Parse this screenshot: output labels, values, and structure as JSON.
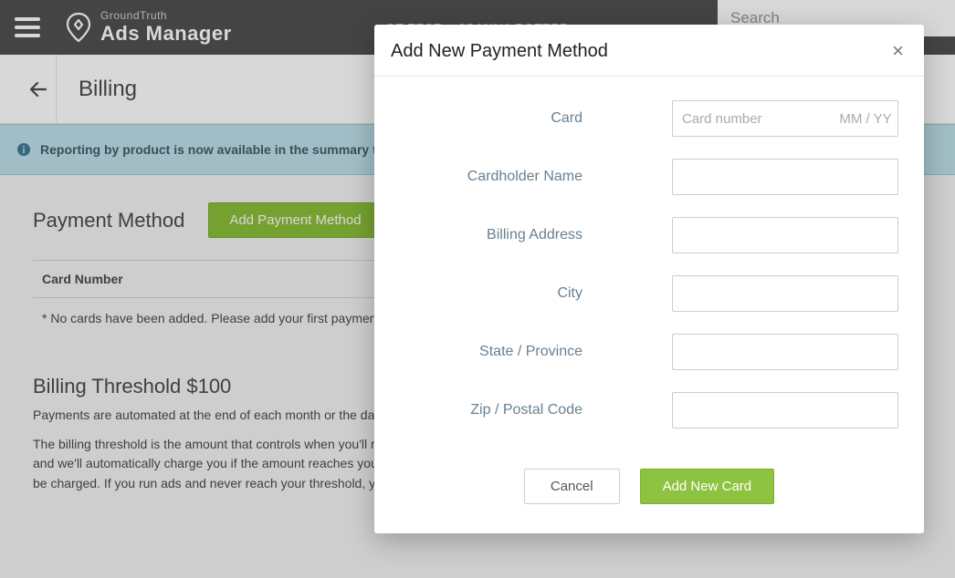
{
  "header": {
    "brand_sub": "GroundTruth",
    "brand_main": "Ads Manager",
    "account_label": "GT TEST",
    "user_label": "JOANNA POTTER",
    "search_placeholder": "Search"
  },
  "page": {
    "title": "Billing"
  },
  "banner": {
    "text": "Reporting by product is now available in the summary tab for the campaign and ad group reporting pages."
  },
  "payment_method": {
    "title": "Payment Method",
    "add_button": "Add Payment Method",
    "table_header": "Card Number",
    "empty_text": "* No cards have been added. Please add your first payment method."
  },
  "threshold": {
    "title": "Billing Threshold $100",
    "line1": "Payments are automated at the end of each month or the day you reach your billing threshold.",
    "line2": "The billing threshold is the amount that controls when you'll receive a bill based on the cost of your ads. Your ads will run and accrue ad costs, and we'll automatically charge you if the amount reaches your billing threshold. If you reach the threshold in a given month, your credit card will be charged. If you run ads and never reach your threshold, you'll receive the final bill at the end of each month."
  },
  "modal": {
    "title": "Add New Payment Method",
    "labels": {
      "card": "Card",
      "cardholder": "Cardholder Name",
      "address": "Billing Address",
      "city": "City",
      "state": "State / Province",
      "zip": "Zip / Postal Code"
    },
    "placeholders": {
      "card_number": "Card number",
      "card_expiry": "MM / YY"
    },
    "cancel_button": "Cancel",
    "add_button": "Add New Card"
  }
}
